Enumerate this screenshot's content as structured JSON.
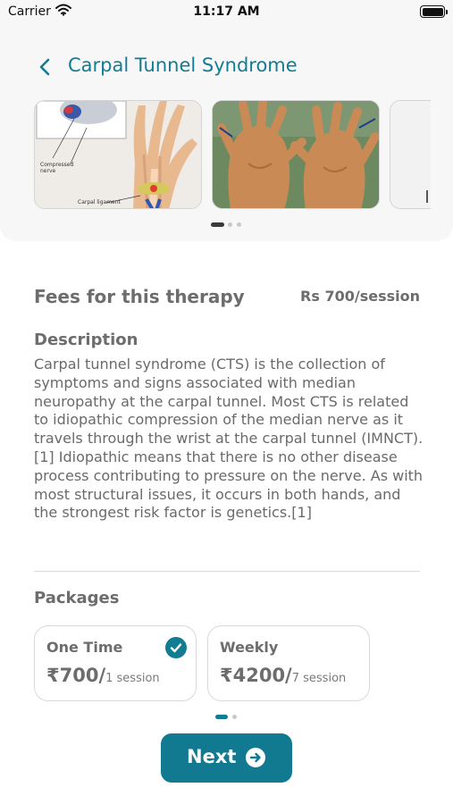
{
  "status_bar": {
    "carrier": "Carrier",
    "time": "11:17 AM"
  },
  "header": {
    "title": "Carpal Tunnel Syndrome",
    "back_icon": "chevron-left-icon"
  },
  "carousel": {
    "slides": [
      {
        "image": "carpal-tunnel-diagram",
        "labels": [
          "Compressed nerve",
          "Carpal ligament"
        ]
      },
      {
        "image": "hands-photo"
      },
      {
        "image": "partial-slide"
      }
    ],
    "active_index": 0,
    "count": 3
  },
  "fees": {
    "label": "Fees for this therapy",
    "value": "Rs 700/session"
  },
  "description": {
    "heading": "Description",
    "text": "Carpal tunnel syndrome (CTS) is the collection of symptoms and signs associated with median neuropathy at the carpal tunnel. Most CTS is related to idiopathic compression of the median nerve as it travels through the wrist at the carpal tunnel (IMNCT).[1] Idiopathic means that there is no other disease process contributing to pressure on the nerve. As with most structural issues, it occurs in both hands, and the strongest risk factor is genetics.[1]"
  },
  "packages": {
    "heading": "Packages",
    "items": [
      {
        "name": "One Time",
        "amount": "₹700/",
        "sessions": "1 session",
        "selected": true
      },
      {
        "name": "Weekly",
        "amount": "₹4200/",
        "sessions": "7 session",
        "selected": false
      }
    ],
    "page_count": 2,
    "active_page": 0
  },
  "next_button": {
    "label": "Next",
    "icon": "arrow-right-circle-icon"
  },
  "colors": {
    "accent": "#127c93",
    "text": "#6d6d6d",
    "card_bg": "#f7f7f7"
  }
}
